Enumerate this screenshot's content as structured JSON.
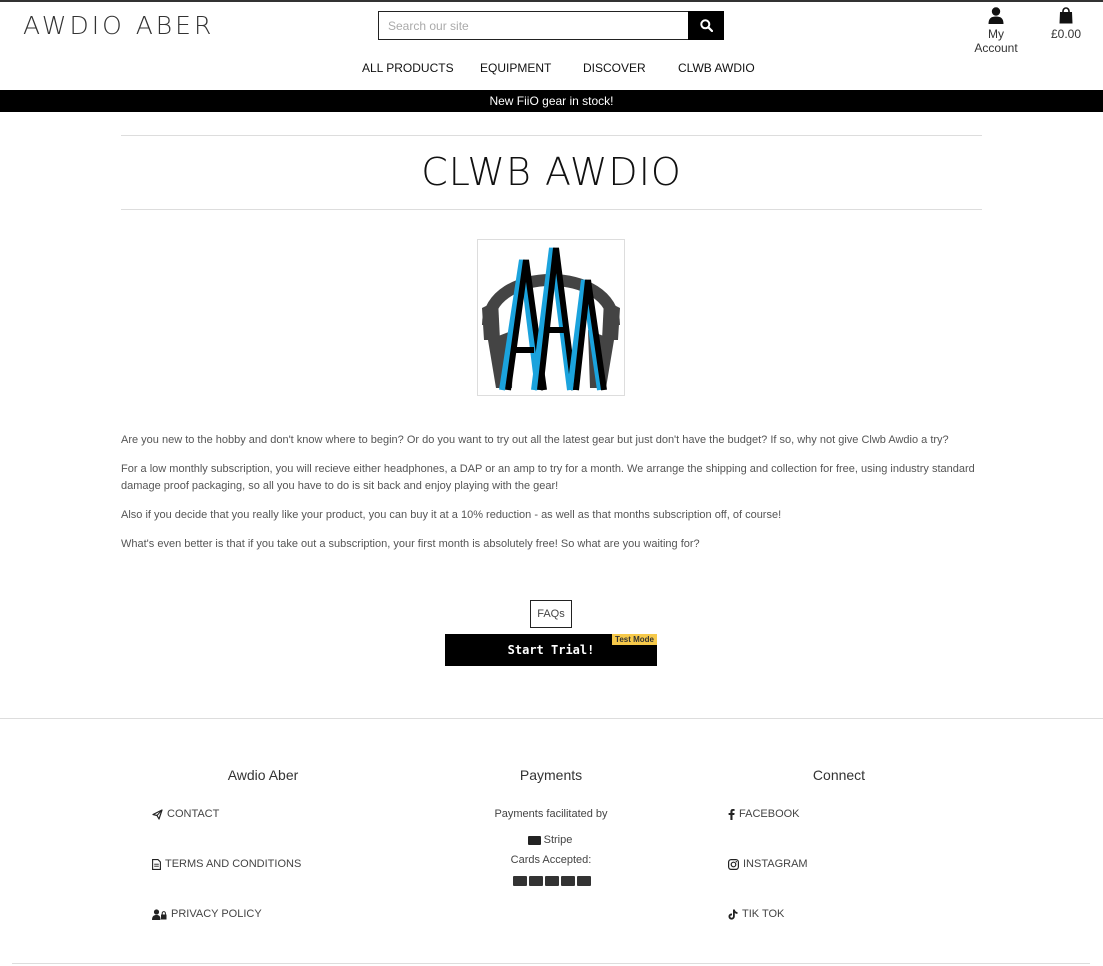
{
  "header": {
    "logo": "AWDIO ABER",
    "search_placeholder": "Search our site",
    "account_label": "My Account",
    "cart_total": "£0.00"
  },
  "nav": {
    "items": [
      "ALL PRODUCTS",
      "EQUIPMENT",
      "DISCOVER",
      "CLWB AWDIO"
    ]
  },
  "banner": {
    "text": "New FiiO gear in stock!"
  },
  "page": {
    "title": "CLWB AWDIO",
    "paragraphs": [
      "Are you new to the hobby and don't know where to begin? Or do you want to try out all the latest gear but just don't have the budget? If so, why not give Clwb Awdio a try?",
      "For a low monthly subscription, you will recieve either headphones, a DAP or an amp to try for a month. We arrange the shipping and collection for free, using industry standard damage proof packaging, so all you have to do is sit back and enjoy playing with the gear!",
      "Also if you decide that you really like your product, you can buy it at a 10% reduction - as well as that months subscription off, of course!",
      "What's even better is that if you take out a subscription, your first month is absolutely free! So what are you waiting for?"
    ],
    "faq_label": "FAQs",
    "trial_label": "Start Trial!",
    "test_mode_label": "Test Mode"
  },
  "footer": {
    "col1": {
      "title": "Awdio Aber",
      "links": [
        "CONTACT",
        "TERMS AND CONDITIONS",
        "PRIVACY POLICY"
      ]
    },
    "col2": {
      "title": "Payments",
      "facilitated": "Payments facilitated by",
      "provider": "Stripe",
      "cards_accepted": "Cards Accepted:"
    },
    "col3": {
      "title": "Connect",
      "links": [
        "FACEBOOK",
        "INSTAGRAM",
        "TIK TOK"
      ]
    }
  },
  "icons": {
    "search": "search-icon",
    "account": "user-icon",
    "cart": "shopping-bag-icon"
  },
  "colors": {
    "accent_blue": "#1ba3dd",
    "headphone_grey": "#444444",
    "banner_bg": "#000000",
    "test_mode": "#f6c94a"
  }
}
